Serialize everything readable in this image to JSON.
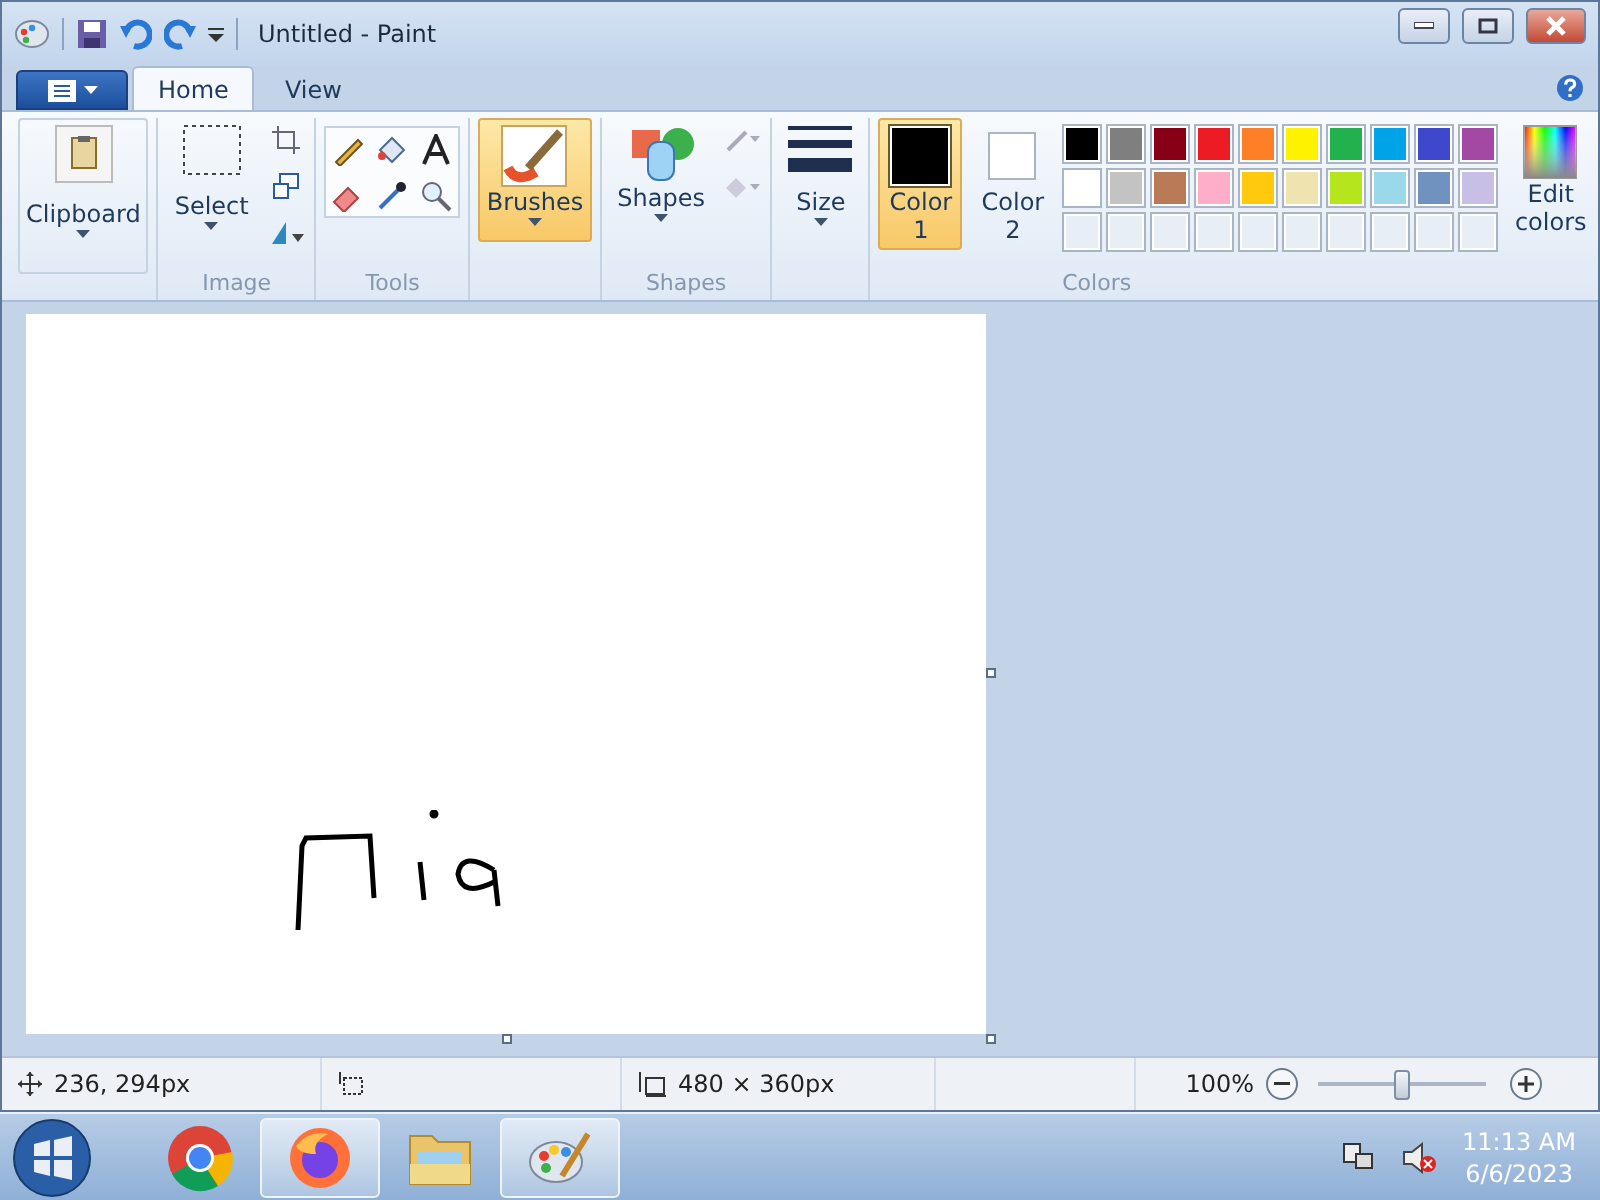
{
  "window": {
    "title": "Untitled - Paint"
  },
  "ribbon": {
    "tabs": [
      {
        "label": "Home",
        "selected": true
      },
      {
        "label": "View",
        "selected": false
      }
    ],
    "clipboard": {
      "label": "Clipboard"
    },
    "image": {
      "select_label": "Select",
      "group_label": "Image"
    },
    "tools": {
      "group_label": "Tools"
    },
    "brushes": {
      "label": "Brushes",
      "selected": true
    },
    "shapes": {
      "label": "Shapes",
      "group_label": "Shapes"
    },
    "size": {
      "label": "Size"
    },
    "colors": {
      "group_label": "Colors",
      "edit_label": "Edit",
      "edit_label_2": "colors",
      "slots": [
        {
          "label": "Color",
          "number": "1",
          "selected": true,
          "color": "#000000"
        },
        {
          "label": "Color",
          "number": "2",
          "selected": false,
          "color": "#ffffff"
        }
      ],
      "palette": [
        {
          "kind": "swatch",
          "color": "#000000"
        },
        {
          "kind": "swatch",
          "color": "#7f7f7f"
        },
        {
          "kind": "swatch",
          "color": "#880015"
        },
        {
          "kind": "swatch",
          "color": "#ed1c24"
        },
        {
          "kind": "swatch",
          "color": "#ff7f27"
        },
        {
          "kind": "swatch",
          "color": "#fff200"
        },
        {
          "kind": "swatch",
          "color": "#22b14c"
        },
        {
          "kind": "swatch",
          "color": "#00a2e8"
        },
        {
          "kind": "swatch",
          "color": "#3f48cc"
        },
        {
          "kind": "swatch",
          "color": "#a349a4"
        },
        {
          "kind": "swatch",
          "color": "#ffffff"
        },
        {
          "kind": "swatch",
          "color": "#c3c3c3"
        },
        {
          "kind": "swatch",
          "color": "#b97a57"
        },
        {
          "kind": "swatch",
          "color": "#ffaec9"
        },
        {
          "kind": "swatch",
          "color": "#ffc90e"
        },
        {
          "kind": "swatch",
          "color": "#efe4b0"
        },
        {
          "kind": "swatch",
          "color": "#b5e61d"
        },
        {
          "kind": "swatch",
          "color": "#99d9ea"
        },
        {
          "kind": "swatch",
          "color": "#7092be"
        },
        {
          "kind": "swatch",
          "color": "#c8bfe7"
        },
        {
          "kind": "empty"
        },
        {
          "kind": "empty"
        },
        {
          "kind": "empty"
        },
        {
          "kind": "empty"
        },
        {
          "kind": "empty"
        },
        {
          "kind": "empty"
        },
        {
          "kind": "empty"
        },
        {
          "kind": "empty"
        },
        {
          "kind": "empty"
        },
        {
          "kind": "empty"
        }
      ]
    }
  },
  "status_bar": {
    "cursor": "236, 294px",
    "canvas_size": "480 × 360px",
    "zoom": "100%",
    "zoom_slider": {
      "level": 0.5
    }
  },
  "taskbar": {
    "apps": [
      {
        "kind": "chrome",
        "open": false
      },
      {
        "kind": "firefox",
        "open": true
      },
      {
        "kind": "folder",
        "open": false
      },
      {
        "kind": "paint",
        "open": true
      }
    ],
    "time": "11:13 AM",
    "date": "6/6/2023"
  }
}
